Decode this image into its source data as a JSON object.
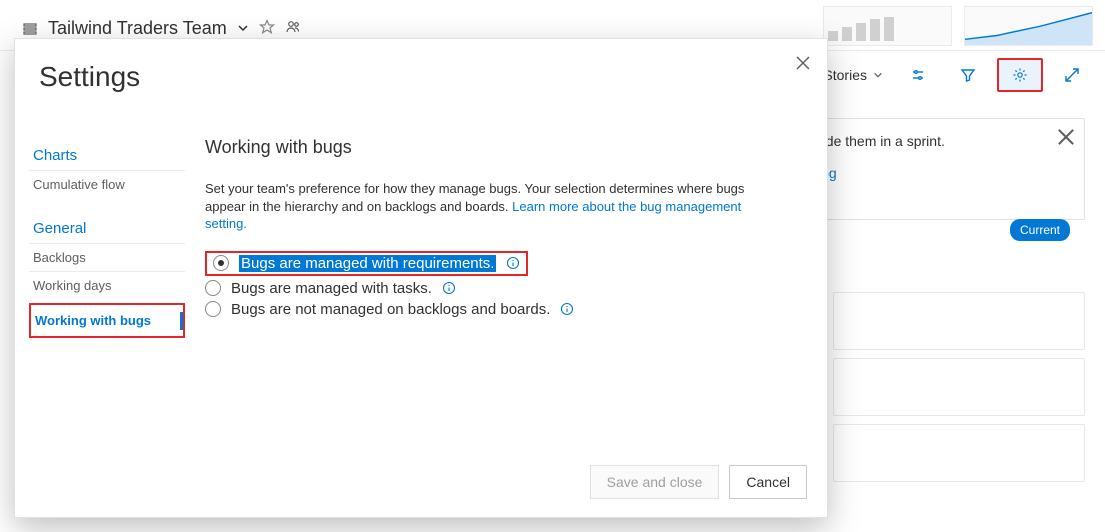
{
  "background": {
    "team_name": "Tailwind Traders Team",
    "toolbar": {
      "stories_label": "Stories"
    },
    "card": {
      "text_fragment": "ude them in a sprint.",
      "link_fragment": "log",
      "badge": "Current"
    }
  },
  "modal": {
    "title": "Settings",
    "sidebar": {
      "section_charts": "Charts",
      "item_cumulative": "Cumulative flow",
      "section_general": "General",
      "item_backlogs": "Backlogs",
      "item_working_days": "Working days",
      "item_working_bugs": "Working with bugs"
    },
    "panel": {
      "title": "Working with bugs",
      "desc_prefix": "Set your team's preference for how they manage bugs. Your selection determines where bugs appear in the hierarchy and on backlogs and boards. ",
      "desc_link": "Learn more about the bug management setting.",
      "options": {
        "opt1": "Bugs are managed with requirements.",
        "opt2": "Bugs are managed with tasks.",
        "opt3": "Bugs are not managed on backlogs and boards."
      }
    },
    "footer": {
      "save": "Save and close",
      "cancel": "Cancel"
    }
  }
}
